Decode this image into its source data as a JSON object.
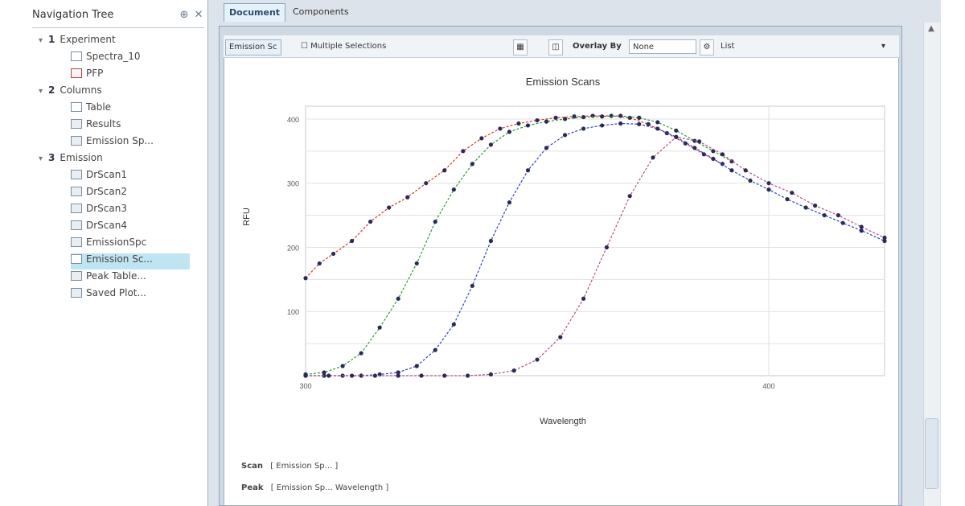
{
  "navigation": {
    "title": "Navigation Tree",
    "items": [
      {
        "label": "Experiment",
        "level": 0,
        "kind": "group",
        "number": "1"
      },
      {
        "label": "Spectra_10",
        "level": 1,
        "kind": "doc"
      },
      {
        "label": "PFP",
        "level": 1,
        "kind": "red"
      },
      {
        "label": "Columns",
        "level": 0,
        "kind": "group",
        "number": "2"
      },
      {
        "label": "Table",
        "level": 1,
        "kind": "doc"
      },
      {
        "label": "Results",
        "level": 1,
        "kind": "grid"
      },
      {
        "label": "Emission Sp...",
        "level": 1,
        "kind": "grid"
      },
      {
        "label": "Emission",
        "level": 0,
        "kind": "group",
        "number": "3"
      },
      {
        "label": "DrScan1",
        "level": 1,
        "kind": "grid"
      },
      {
        "label": "DrScan2",
        "level": 1,
        "kind": "grid"
      },
      {
        "label": "DrScan3",
        "level": 1,
        "kind": "grid"
      },
      {
        "label": "DrScan4",
        "level": 1,
        "kind": "grid"
      },
      {
        "label": "EmissionSpc",
        "level": 1,
        "kind": "grid"
      },
      {
        "label": "Emission Sc...",
        "level": 1,
        "kind": "doc",
        "selected": true
      },
      {
        "label": "Peak Table...",
        "level": 1,
        "kind": "grid"
      },
      {
        "label": "Saved Plot...",
        "level": 1,
        "kind": "grid"
      }
    ]
  },
  "tabs": [
    {
      "label": "Document",
      "active": true
    },
    {
      "label": "Components",
      "active": false
    }
  ],
  "toolbar": {
    "view_button": "Emission Sc",
    "show_label": "Multiple Selections",
    "overlay_label": "Overlay By",
    "overlay_value": "None",
    "list_label": "List"
  },
  "chart_data": {
    "type": "line",
    "title": "Emission Scans",
    "xlabel": "Wavelength",
    "ylabel": "RFU",
    "x_ticks": [
      "300",
      "400"
    ],
    "y_ticks": [
      "100",
      "200",
      "300",
      "400"
    ],
    "xlim": [
      300,
      425
    ],
    "ylim": [
      0,
      420
    ],
    "grid": true,
    "series": [
      {
        "color": "#d43a2a",
        "x": [
          300,
          303,
          306,
          310,
          314,
          318,
          322,
          326,
          330,
          334,
          338,
          342,
          346,
          350,
          354,
          358,
          362,
          366,
          370,
          374,
          378,
          382,
          386,
          390
        ],
        "y": [
          152,
          175,
          190,
          210,
          240,
          262,
          278,
          300,
          320,
          350,
          370,
          385,
          393,
          398,
          402,
          404,
          405,
          405,
          402,
          392,
          378,
          362,
          345,
          330
        ]
      },
      {
        "color": "#2e9a3a",
        "x": [
          300,
          304,
          308,
          312,
          316,
          320,
          324,
          328,
          332,
          336,
          340,
          344,
          348,
          352,
          356,
          360,
          364,
          368,
          372,
          376,
          380,
          384,
          388,
          392
        ],
        "y": [
          2,
          5,
          15,
          35,
          75,
          120,
          175,
          240,
          290,
          330,
          360,
          380,
          390,
          396,
          400,
          403,
          404,
          405,
          402,
          395,
          382,
          366,
          350,
          334
        ]
      },
      {
        "color": "#2a3fd0",
        "x": [
          300,
          304,
          308,
          312,
          316,
          320,
          324,
          328,
          332,
          336,
          340,
          344,
          348,
          352,
          356,
          360,
          364,
          368,
          372,
          376,
          380,
          384,
          388,
          392,
          396,
          400,
          404,
          408,
          412,
          416,
          420,
          425
        ],
        "y": [
          0,
          0,
          0,
          0,
          2,
          5,
          15,
          40,
          80,
          140,
          210,
          270,
          320,
          355,
          375,
          385,
          390,
          393,
          392,
          385,
          372,
          355,
          338,
          320,
          304,
          290,
          275,
          262,
          250,
          238,
          226,
          210
        ]
      },
      {
        "color": "#b0508a",
        "x": [
          300,
          305,
          310,
          315,
          320,
          325,
          330,
          335,
          340,
          345,
          350,
          355,
          360,
          365,
          370,
          375,
          380,
          385,
          390,
          395,
          400,
          405,
          410,
          415,
          420,
          425
        ],
        "y": [
          0,
          0,
          0,
          0,
          0,
          0,
          0,
          0,
          2,
          8,
          25,
          60,
          120,
          200,
          280,
          340,
          372,
          365,
          345,
          320,
          300,
          285,
          265,
          250,
          232,
          215
        ]
      }
    ]
  },
  "legend": [
    {
      "key": "Scan",
      "text": "[ Emission Sp... ]"
    },
    {
      "key": "Peak",
      "text": "[ Emission Sp... Wavelength ]"
    }
  ],
  "scroll": {
    "up_icon": "▲"
  }
}
